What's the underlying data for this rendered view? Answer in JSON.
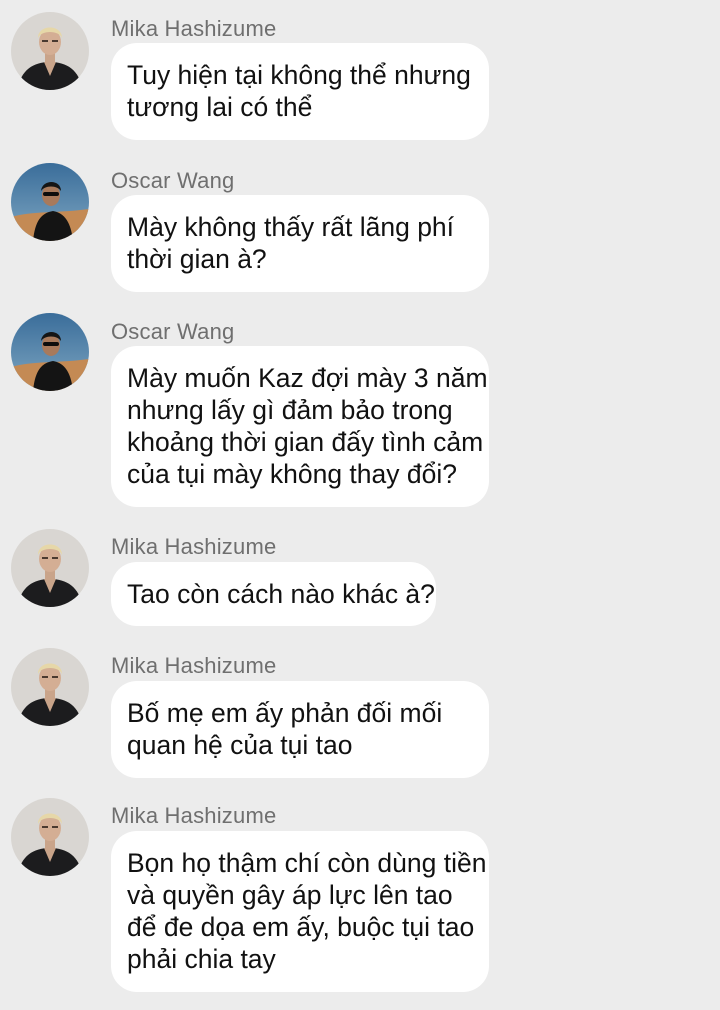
{
  "messages": [
    {
      "sender": "Mika Hashizume",
      "avatar": "mika-avatar",
      "lines": [
        "Tuy hiện tại không thể nhưng",
        "tương lai có thể"
      ]
    },
    {
      "sender": "Oscar Wang",
      "avatar": "oscar-avatar",
      "lines": [
        "Mày không thấy rất lãng phí",
        "thời gian à?"
      ]
    },
    {
      "sender": "Oscar Wang",
      "avatar": "oscar-avatar",
      "lines": [
        "Mày muốn Kaz đợi mày 3 năm",
        "nhưng lấy gì đảm bảo trong",
        "khoảng thời gian đấy tình cảm",
        "của tụi mày không thay đổi?"
      ]
    },
    {
      "sender": "Mika Hashizume",
      "avatar": "mika-avatar",
      "lines": [
        "Tao còn cách nào khác à?"
      ]
    },
    {
      "sender": "Mika Hashizume",
      "avatar": "mika-avatar",
      "lines": [
        "Bố mẹ em ấy phản đối mối",
        "quan hệ của tụi tao"
      ]
    },
    {
      "sender": "Mika Hashizume",
      "avatar": "mika-avatar",
      "lines": [
        "Bọn họ thậm chí còn dùng tiền",
        "và quyền gây áp lực lên tao",
        "để đe dọa em ấy, buộc tụi tao",
        "phải chia tay"
      ]
    }
  ]
}
